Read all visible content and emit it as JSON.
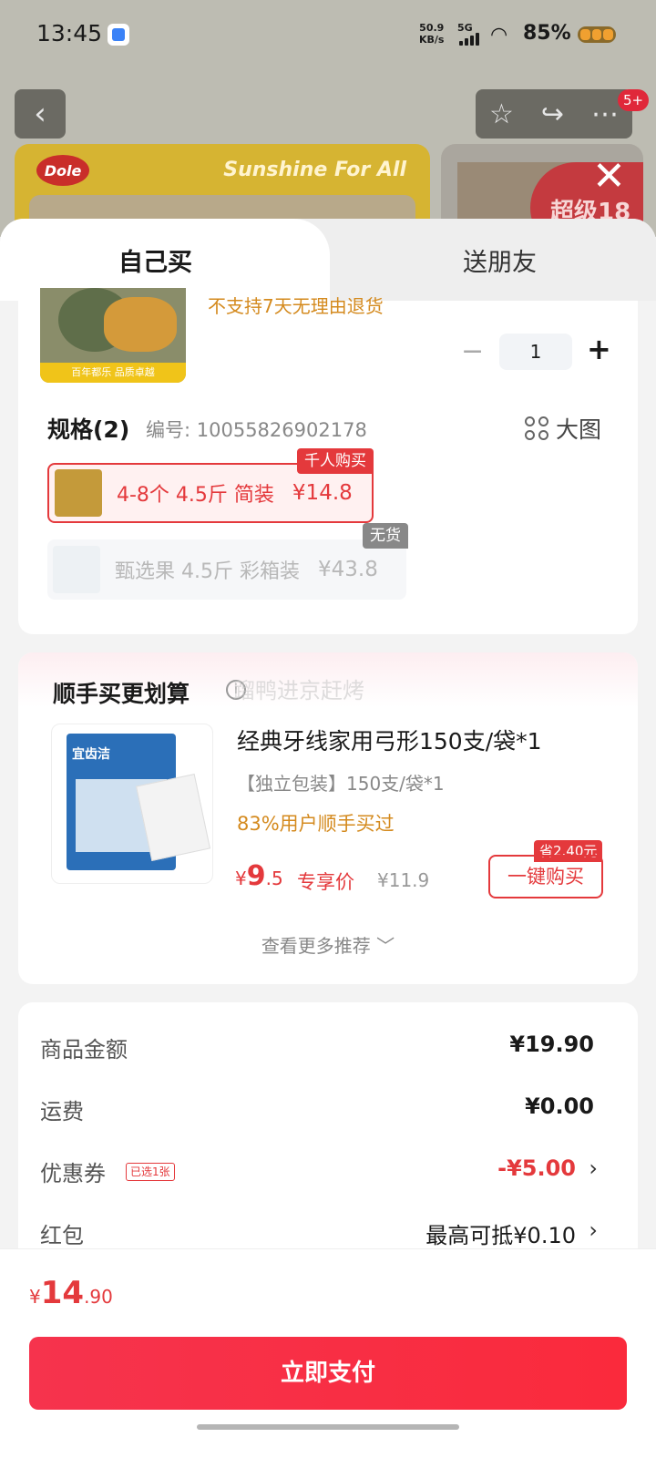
{
  "status_bar": {
    "time": "13:45",
    "speed_value": "50.9",
    "speed_unit": "KB/s",
    "network": "5G",
    "battery": "85%"
  },
  "background": {
    "badge": "5+",
    "brand": "Dole",
    "tagline": "Sunshine For All",
    "promo": "超级18"
  },
  "tabs": {
    "self": "自己买",
    "friend": "送朋友"
  },
  "product": {
    "notice": "不支持7天无理由退货",
    "thumb_strip": "百年都乐 品质卓越",
    "quantity": "1",
    "quantity_minus": "−",
    "quantity_plus": "+"
  },
  "spec": {
    "title": "规格(2)",
    "code": "编号: 10055826902178",
    "big_image": "大图",
    "options": [
      {
        "label": "4-8个 4.5斤 简装",
        "price": "¥14.8",
        "badge": "千人购买"
      },
      {
        "label": "甄选果 4.5斤 彩箱装",
        "price": "¥43.8",
        "badge": "无货"
      }
    ]
  },
  "addon": {
    "title": "顺手买更划算",
    "watermark": "蹓鸭进京赶烤",
    "brand": "宜齿洁",
    "name": "经典牙线家用弓形150支/袋*1",
    "sub": "【独立包装】150支/袋*1",
    "stat": "83%用户顺手买过",
    "price_symbol": "¥",
    "price_int": "9",
    "price_dec": ".5",
    "price_label": "专享价",
    "original_price": "¥11.9",
    "save_badge": "省2.40元",
    "buy_label": "一键购买",
    "more": "查看更多推荐 ﹀"
  },
  "summary": {
    "rows": [
      {
        "label": "商品金额",
        "value": "¥19.90"
      },
      {
        "label": "运费",
        "value": "¥0.00"
      },
      {
        "label": "优惠券",
        "value": "-¥5.00",
        "tag": "已选1张"
      },
      {
        "label": "红包",
        "value": "最高可抵¥0.10"
      }
    ]
  },
  "bottom": {
    "price_symbol": "¥",
    "price_int": "14",
    "price_dec": ".90",
    "pay_label": "立即支付"
  },
  "colors": {
    "accent": "#e4393c",
    "notice": "#d48a1e"
  }
}
